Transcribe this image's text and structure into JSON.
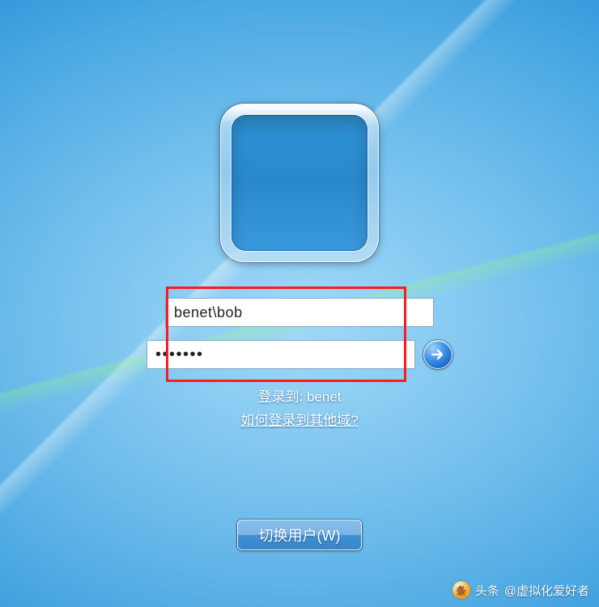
{
  "login": {
    "username_value": "benet\\bob",
    "password_value": "•••••••",
    "username_placeholder": "",
    "password_placeholder": ""
  },
  "hints": {
    "login_to_prefix": "登录到:",
    "domain": "benet",
    "help_link": "如何登录到其他域?"
  },
  "buttons": {
    "switch_user": "切换用户(W)"
  },
  "watermark": {
    "label": "头条",
    "author": "@虚拟化爱好者"
  }
}
